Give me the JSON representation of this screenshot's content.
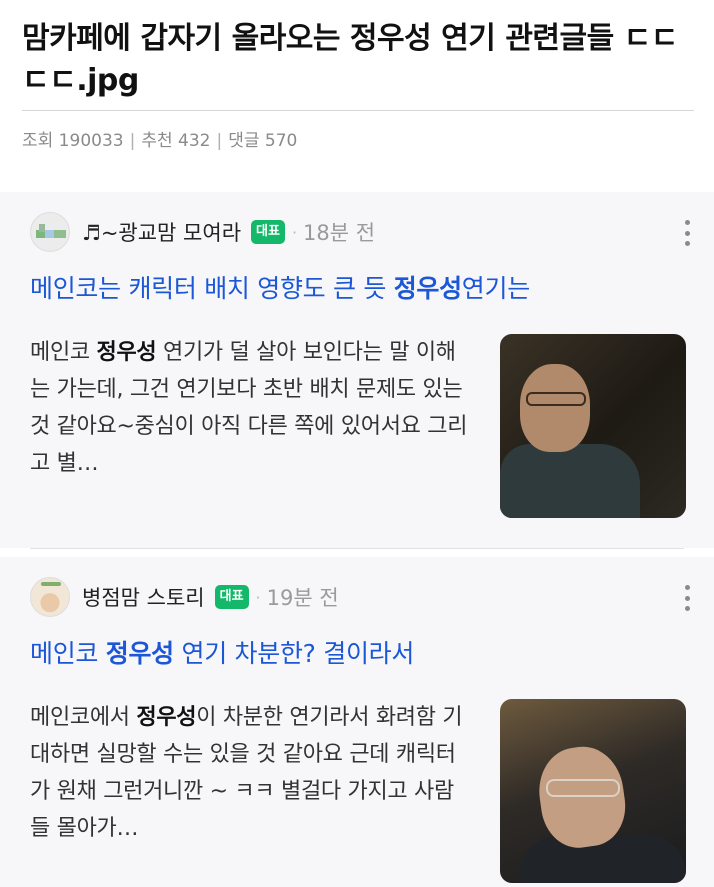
{
  "post": {
    "title": "맘카페에 갑자기 올라오는 정우성 연기 관련글들 ㄷㄷㄷㄷ.jpg",
    "views_label": "조회 190033",
    "recommend_label": "추천 432",
    "comments_label": "댓글 570",
    "separator": "|"
  },
  "results": [
    {
      "source_name": "♬~광교맘 모여라",
      "badge": "대표",
      "dot": "·",
      "time": "18분 전",
      "headline_pre": "메인코는 캐릭터 배치 영향도 큰 듯 ",
      "headline_bold": "정우성",
      "headline_post": "연기는",
      "excerpt_pre": "메인코 ",
      "excerpt_bold": "정우성",
      "excerpt_post": " 연기가 덜 살아 보인다는 말 이해는 가는데, 그건 연기보다 초반 배치 문제도 있는 것 같아요~중심이 아직 다른 쪽에 있어서요 그리고 별…"
    },
    {
      "source_name": "병점맘 스토리",
      "badge": "대표",
      "dot": "·",
      "time": "19분 전",
      "headline_pre": "메인코 ",
      "headline_bold": "정우성",
      "headline_post": " 연기 차분한? 결이라서",
      "excerpt_pre": "메인코에서 ",
      "excerpt_bold": "정우성",
      "excerpt_post": "이 차분한 연기라서 화려함 기대하면 실망할 수는 있을 것 같아요 근데 캐릭터가 원채 그런거니깐 ~ ㅋㅋ 별걸다 가지고 사람들 몰아가…"
    }
  ],
  "colors": {
    "headline_blue": "#1b57d6",
    "badge_green": "#14b86a",
    "card_bg": "#f7f7f9"
  },
  "icons": [
    "more-vertical-icon",
    "source-avatar"
  ]
}
